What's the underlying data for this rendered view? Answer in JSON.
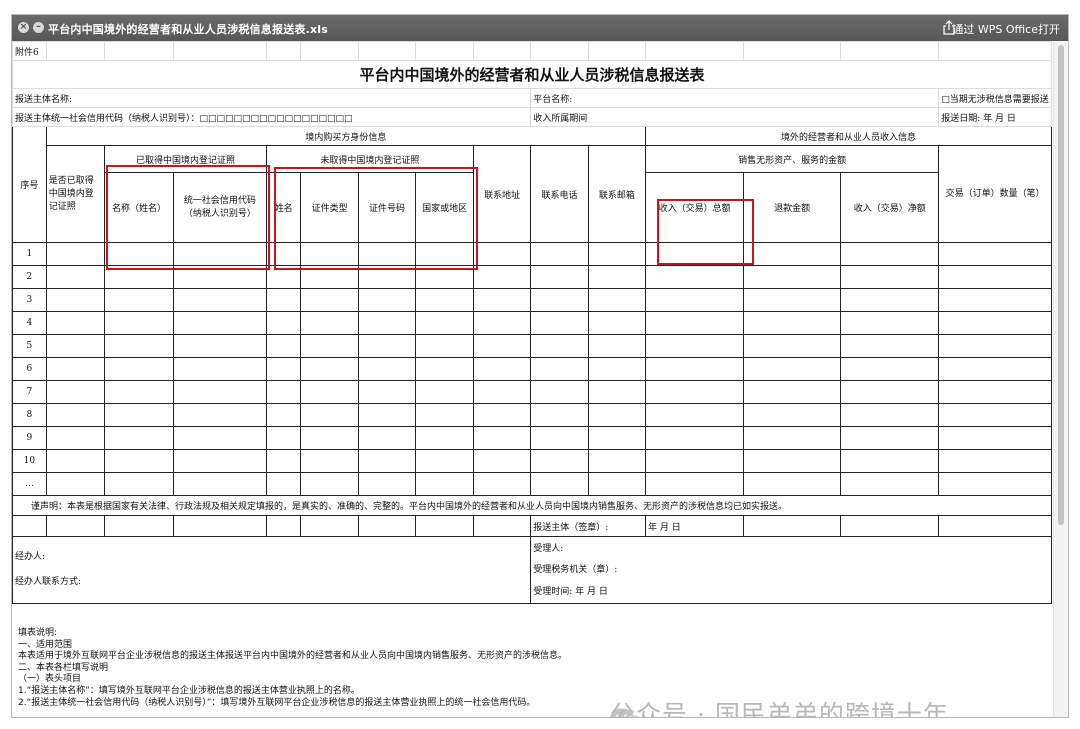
{
  "window": {
    "title": "平台内中国境外的经营者和从业人员涉税信息报送表.xls",
    "open_with": "通过 WPS Office打开"
  },
  "sheet": {
    "attachment": "附件6",
    "title": "平台内中国境外的经营者和从业人员涉税信息报送表",
    "reporter_name_label": "报送主体名称:",
    "platform_name_label": "平台名称:",
    "no_info_note": "□当期无涉税信息需要报送",
    "credit_code_label": "报送主体统一社会信用代码（纳税人识别号）：□□□□□□□□□□□□□□□□□□",
    "income_period_label": "收入所属期间",
    "report_date_label": "报送日期:   年 月 日",
    "group_buyer": "境内购买方身份信息",
    "group_seller": "境外的经营者和从业人员收入信息",
    "col_seq": "序号",
    "col_has_license": "是否已取得中国境内登记证照",
    "group_licensed": "已取得中国境内登记证照",
    "group_unlicensed": "未取得中国境内登记证照",
    "col_name": "名称（姓名）",
    "col_credit_code": "统一社会信用代码（纳税人识别号）",
    "col_person_name": "姓名",
    "col_id_type": "证件类型",
    "col_id_number": "证件号码",
    "col_country": "国家或地区",
    "col_address": "联系地址",
    "col_phone": "联系电话",
    "col_email": "联系邮箱",
    "group_sales": "销售无形资产、服务的金额",
    "col_gross_income": "收入（交易）总额",
    "col_refund": "退款金额",
    "col_net_income": "收入（交易）净额",
    "col_order_count": "交易（订单）数量（笔）",
    "row_numbers": [
      "1",
      "2",
      "3",
      "4",
      "5",
      "6",
      "7",
      "8",
      "9",
      "10",
      "…"
    ],
    "declaration": "谨声明：本表是根据国家有关法律、行政法规及相关规定填报的，是真实的、准确的、完整的。平台内中国境外的经营者和从业人员向中国境内销售服务、无形资产的涉税信息均已如实报送。",
    "reporter_seal": "报送主体（签章）:",
    "seal_date": "年  月  日",
    "handler": "经办人:",
    "handler_contact": "经办人联系方式:",
    "receiver": "受理人:",
    "tax_office": "受理税务机关（章）:",
    "receive_time": "受理时间:    年  月  日"
  },
  "notes": [
    "填表说明:",
    "  一、适用范围",
    "  本表适用于境外互联网平台企业涉税信息的报送主体报送平台内中国境外的经营者和从业人员向中国境内销售服务、无形资产的涉税信息。",
    "  二、本表各栏填写说明",
    "  （一）表头项目",
    "  1.“报送主体名称”：填写境外互联网平台企业涉税信息的报送主体营业执照上的名称。",
    "  2.“报送主体统一社会信用代码（纳税人识别号）”：填写境外互联网平台企业涉税信息的报送主体营业执照上的统一社会信用代码。"
  ],
  "watermark": "公众号 · 国民弟弟的跨境十年",
  "colors": {
    "highlight": "#c8161d",
    "titlebar": "#5e5e5e"
  }
}
